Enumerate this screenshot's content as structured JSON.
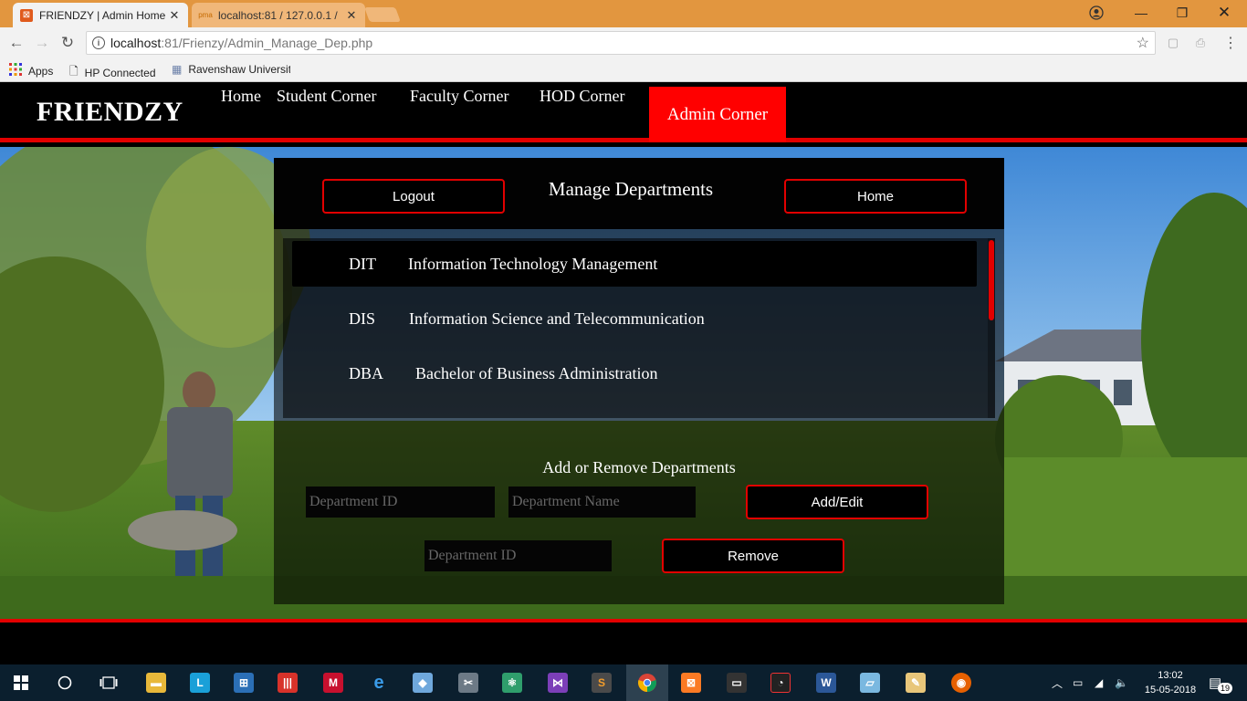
{
  "browser": {
    "tabs": [
      {
        "title": "FRIENDZY | Admin Home",
        "active": true
      },
      {
        "title": "localhost:81 / 127.0.0.1 /",
        "active": false
      }
    ],
    "url_host": "localhost",
    "url_rest": ":81/Frienzy/Admin_Manage_Dep.php",
    "bookmarks": [
      "Apps",
      "HP Connected",
      "Ravenshaw University"
    ]
  },
  "site": {
    "brand": "FRIENDZY",
    "nav": [
      "Home",
      "Student Corner",
      "Faculty Corner",
      "HOD Corner",
      "Admin Corner"
    ],
    "active_nav": "Admin Corner"
  },
  "panel": {
    "title": "Manage Departments",
    "logout_label": "Logout",
    "home_label": "Home",
    "departments": [
      {
        "id": "DIT",
        "name": "Information Technology Management"
      },
      {
        "id": "DIS",
        "name": "Information Science and Telecommunication"
      },
      {
        "id": "DBA",
        "name": "Bachelor of Business Administration"
      }
    ],
    "add_remove_title": "Add or Remove Departments",
    "add_id_placeholder": "Department ID",
    "add_name_placeholder": "Department Name",
    "add_edit_label": "Add/Edit",
    "remove_id_placeholder": "Department ID",
    "remove_label": "Remove"
  },
  "taskbar": {
    "time": "13:02",
    "date": "15-05-2018",
    "notification_count": "19"
  },
  "colors": {
    "accent_red": "#e20000",
    "active_nav_bg": "#ff0000",
    "chrome_orange": "#e2963f",
    "taskbar": "#0b1f2e"
  }
}
